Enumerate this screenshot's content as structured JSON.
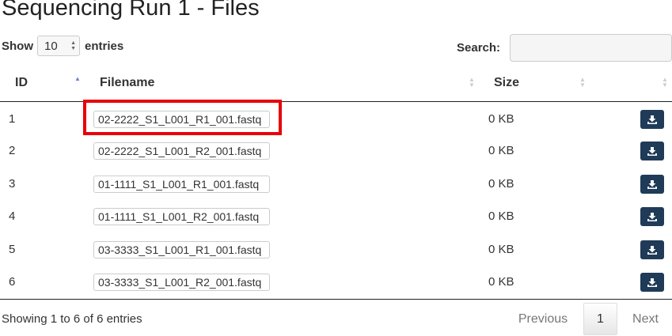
{
  "page": {
    "title": "Sequencing Run 1 - Files"
  },
  "length_menu": {
    "show_label": "Show",
    "value": "10",
    "entries_label": "entries"
  },
  "search": {
    "label": "Search:",
    "value": ""
  },
  "table": {
    "columns": [
      "ID",
      "Filename",
      "Size",
      ""
    ],
    "sort": {
      "column": "ID",
      "direction": "ascending"
    },
    "rows": [
      {
        "id": "1",
        "filename": "02-2222_S1_L001_R1_001.fastq",
        "size": "0 KB"
      },
      {
        "id": "2",
        "filename": "02-2222_S1_L001_R2_001.fastq",
        "size": "0 KB"
      },
      {
        "id": "3",
        "filename": "01-1111_S1_L001_R1_001.fastq",
        "size": "0 KB"
      },
      {
        "id": "4",
        "filename": "01-1111_S1_L001_R2_001.fastq",
        "size": "0 KB"
      },
      {
        "id": "5",
        "filename": "03-3333_S1_L001_R1_001.fastq",
        "size": "0 KB"
      },
      {
        "id": "6",
        "filename": "03-3333_S1_L001_R2_001.fastq",
        "size": "0 KB"
      }
    ]
  },
  "footer": {
    "info": "Showing 1 to 6 of 6 entries",
    "previous": "Previous",
    "current_page": "1",
    "next": "Next"
  },
  "colors": {
    "download_button": "#1f3b57",
    "highlight": "#e8000b",
    "sort_active": "#6f7fcf"
  },
  "icons": {
    "download": "download-icon"
  }
}
